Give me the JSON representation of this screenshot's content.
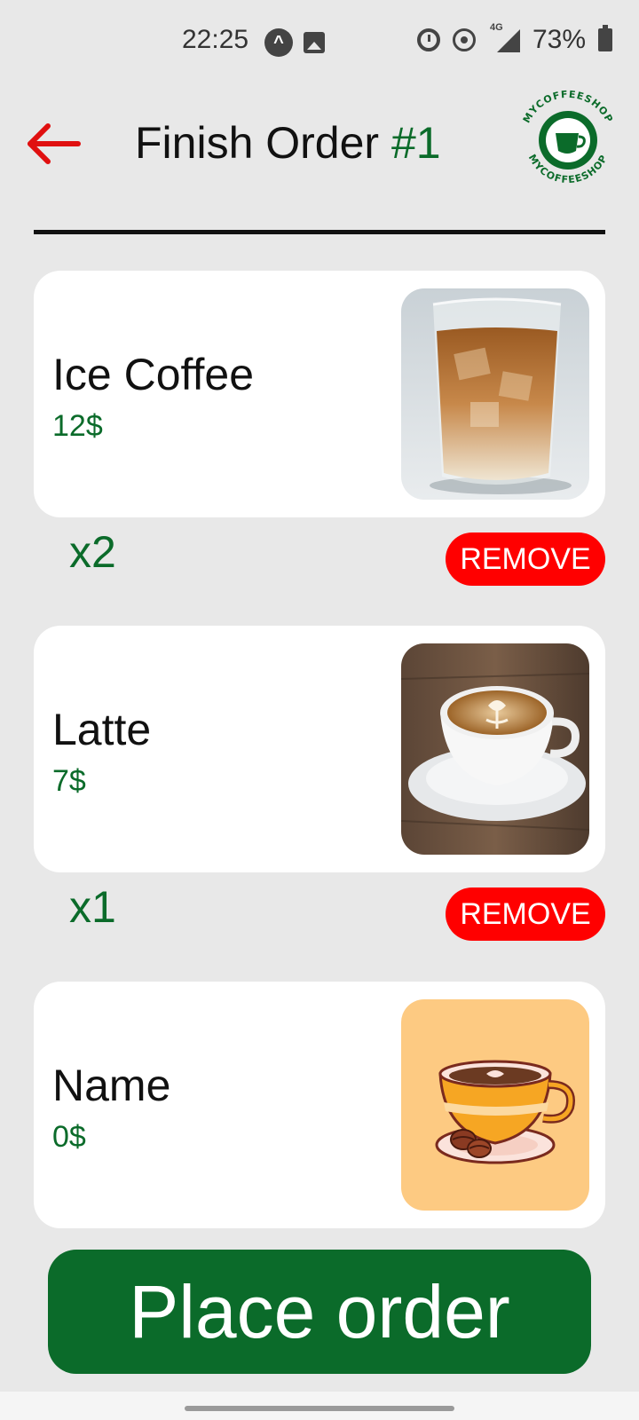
{
  "status_bar": {
    "time": "22:25",
    "network": "4G",
    "battery": "73%"
  },
  "header": {
    "title": "Finish Order",
    "order_number": "#1",
    "logo_text": "MYCOFFEESHOP"
  },
  "items": [
    {
      "name": "Ice Coffee",
      "price": "12$",
      "quantity": "x2",
      "remove_label": "REMOVE",
      "image": "iced-coffee-photo"
    },
    {
      "name": "Latte",
      "price": "7$",
      "quantity": "x1",
      "remove_label": "REMOVE",
      "image": "latte-photo"
    },
    {
      "name": "Name",
      "price": "0$",
      "image": "coffee-cup-illustration"
    }
  ],
  "actions": {
    "place_order_label": "Place order"
  },
  "colors": {
    "background": "#e8e8e8",
    "brand_green": "#0b6b2a",
    "remove_red": "#ff0000",
    "back_arrow_red": "#e01010"
  }
}
